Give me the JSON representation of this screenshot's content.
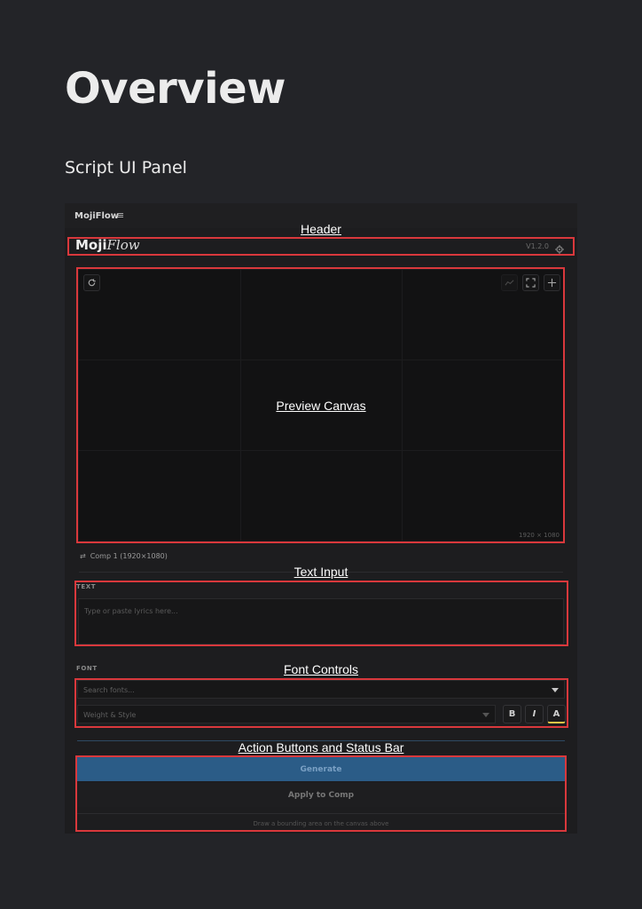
{
  "doc": {
    "title": "Overview",
    "section": "Script UI Panel"
  },
  "panel": {
    "titlebar_name": "MojiFlow",
    "menu_glyph": "≡",
    "logo_main": "Moji",
    "logo_script": "Flow",
    "version": "V1.2.0",
    "canvas_size": "1920 × 1080",
    "comp_icon": "⇄",
    "comp_label": "Comp 1 (1920×1080)",
    "text_section_label": "TEXT",
    "text_placeholder": "Type or paste lyrics here...",
    "font_section_label": "FONT",
    "font_search_placeholder": "Search fonts...",
    "weight_placeholder": "Weight & Style",
    "bold_label": "B",
    "italic_label": "I",
    "color_label": "A",
    "generate_label": "Generate",
    "apply_label": "Apply to Comp",
    "status_text": "Draw a bounding area on the canvas above"
  },
  "callouts": {
    "header": "Header",
    "preview_canvas": "Preview Canvas",
    "text_input": "Text Input",
    "font_controls": "Font Controls",
    "action_buttons": "Action Buttons and Status Bar"
  },
  "icons": {
    "reset": "reset-icon",
    "chart": "chart-icon",
    "fullscreen": "fullscreen-icon",
    "crosshair": "crosshair-icon",
    "settings": "gear-icon",
    "comp_swap": "swap-icon",
    "dropdown": "chevron-down-icon"
  },
  "colors": {
    "background": "#232428",
    "panel": "#1d1d1f",
    "callout_border": "#d9383c",
    "generate_button": "#2b5c87",
    "accent_underline": "#e8c547"
  }
}
